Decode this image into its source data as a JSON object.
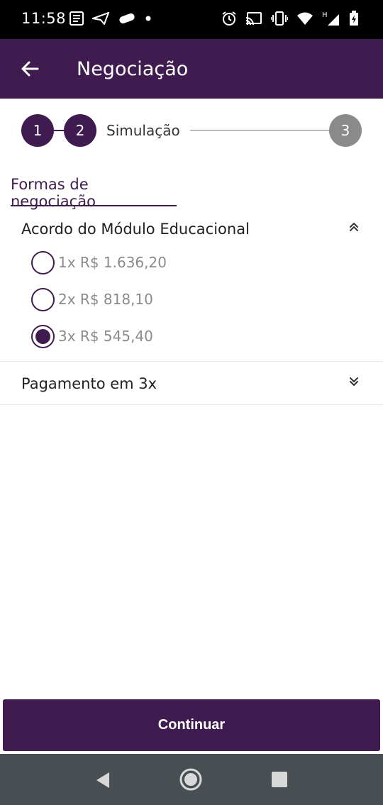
{
  "status_bar": {
    "time": "11:58",
    "left_icons": [
      "news-icon",
      "send-icon",
      "badge-icon",
      "dot-icon"
    ],
    "right_icons": [
      "alarm-icon",
      "cast-icon",
      "vibrate-icon",
      "wifi-icon",
      "signal-icon",
      "battery-icon"
    ],
    "network_type": "H"
  },
  "app_bar": {
    "title": "Negociação",
    "back_icon": "arrow-left-icon"
  },
  "stepper": {
    "steps": [
      {
        "number": "1",
        "state": "completed"
      },
      {
        "number": "2",
        "state": "active",
        "label": "Simulação"
      },
      {
        "number": "3",
        "state": "pending"
      }
    ],
    "active_color": "#3f1b4f",
    "pending_color": "#8a8a8a"
  },
  "tabs": [
    {
      "label": "Formas de negociação",
      "selected": true
    }
  ],
  "accordions": [
    {
      "title": "Acordo do Módulo Educacional",
      "expanded": true,
      "options": [
        {
          "label": "1x R$ 1.636,20",
          "selected": false
        },
        {
          "label": "2x R$ 818,10",
          "selected": false
        },
        {
          "label": "3x R$ 545,40",
          "selected": true
        }
      ]
    },
    {
      "title": "Pagamento em 3x",
      "expanded": false
    }
  ],
  "actions": {
    "continue_label": "Continuar"
  },
  "nav_bar": {
    "icons": [
      "nav-back-icon",
      "nav-home-icon",
      "nav-recents-icon"
    ]
  },
  "colors": {
    "primary": "#3f1b4f",
    "nav_bar": "#474f52",
    "muted_text": "#8a8a8a"
  }
}
